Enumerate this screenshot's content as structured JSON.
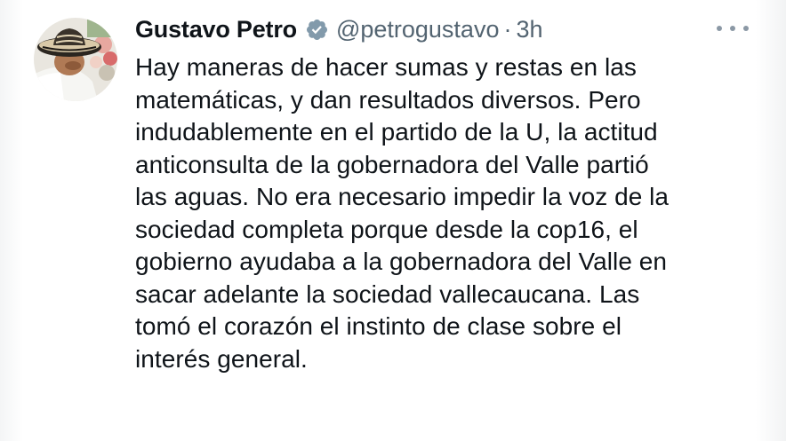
{
  "author": {
    "name": "Gustavo Petro",
    "handle": "@petrogustavo",
    "separator": "·",
    "time": "3h",
    "verified": true,
    "verified_icon": "verified-badge-icon"
  },
  "menu": {
    "icon": "more-options-icon"
  },
  "tweet": {
    "lines": [
      "Hay maneras de hacer sumas y restas en las",
      "matemáticas, y dan resultados diversos. Pero",
      "indudablemente en el partido de la U, la actitud",
      "anticonsulta de la gobernadora del Valle partió",
      "las aguas. No era necesario impedir la voz de la",
      "sociedad completa porque desde la cop16, el",
      "gobierno ayudaba a la gobernadora del Valle en",
      "sacar adelante la sociedad vallecaucana. Las",
      "tomó el corazón el instinto de clase sobre el",
      "interés general."
    ]
  },
  "colors": {
    "text_primary": "#0f1419",
    "text_secondary": "#536471",
    "verified_badge": "#829aab"
  }
}
